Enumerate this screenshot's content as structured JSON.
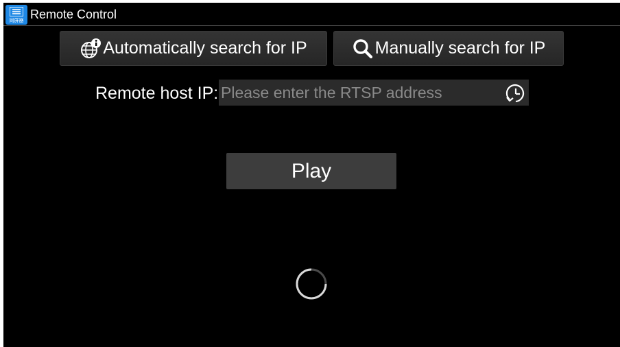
{
  "app": {
    "title": "Remote Control",
    "icon": "remote-control-app-icon",
    "icon_caption": "同屏器"
  },
  "buttons": {
    "auto_search": {
      "label": "Automatically search for IP",
      "icon": "globe-info-icon"
    },
    "manual_search": {
      "label": "Manually search for IP",
      "icon": "search-icon"
    },
    "play": {
      "label": "Play"
    }
  },
  "remote_host": {
    "label": "Remote host IP:",
    "value": "",
    "placeholder": "Please enter the RTSP address",
    "history_icon": "history-clock-icon"
  },
  "status": {
    "loading_icon": "loading-spinner-icon"
  },
  "colors": {
    "background": "#000000",
    "button": "#2e2e2e",
    "input": "#2b2b2b",
    "text": "#ffffff",
    "placeholder": "#8a8a8a",
    "app_icon": "#1e88e5"
  }
}
